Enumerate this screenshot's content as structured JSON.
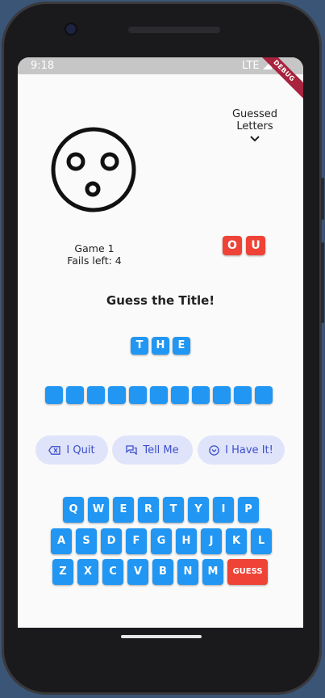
{
  "status_bar": {
    "time": "9:18",
    "network": "LTE",
    "debug_banner": "DEBUG"
  },
  "header": {
    "guessed_letters_label": "Guessed\nLetters",
    "icon": "chevron-down-icon"
  },
  "game": {
    "game_label": "Game 1",
    "fails_label": "Fails left: 4"
  },
  "guessed_letters": [
    "O",
    "U"
  ],
  "title": {
    "heading": "Guess the Title!"
  },
  "revealed_word": [
    "T",
    "H",
    "E"
  ],
  "hidden_word_length": 11,
  "actions": [
    {
      "label": "I Quit",
      "icon": "backspace-icon"
    },
    {
      "label": "Tell Me",
      "icon": "chat-icon"
    },
    {
      "label": "I Have It!",
      "icon": "check-circle-icon"
    }
  ],
  "keyboard": {
    "row1": [
      "Q",
      "W",
      "E",
      "R",
      "T",
      "Y",
      "I",
      "P"
    ],
    "row2": [
      "A",
      "S",
      "D",
      "F",
      "G",
      "H",
      "J",
      "K",
      "L"
    ],
    "row3": [
      "Z",
      "X",
      "C",
      "V",
      "B",
      "N",
      "M"
    ],
    "guess_label": "GUESS"
  },
  "colors": {
    "accent_blue": "#2196f3",
    "accent_red": "#ee4336",
    "action_bg": "#dfe4fa",
    "action_text": "#3c4ecc"
  }
}
